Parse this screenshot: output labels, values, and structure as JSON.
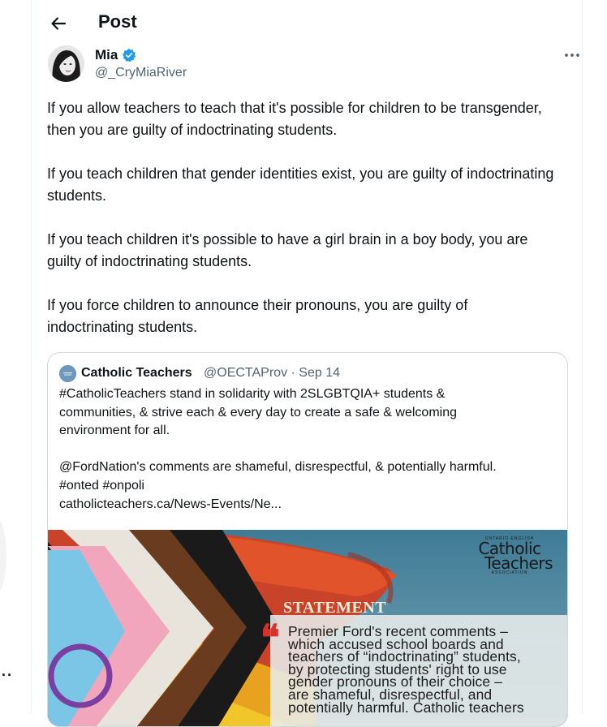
{
  "header": {
    "title": "Post"
  },
  "author": {
    "name": "Mia",
    "handle": "@_CryMiaRiver"
  },
  "post": {
    "paragraphs": [
      "If you allow teachers to teach that it's possible for children to be transgender, then you are guilty of indoctrinating students.",
      "If you teach children that gender identities exist, you are guilty of indoctrinating students.",
      "If you teach children it's possible to have a girl brain in a boy body, you are guilty of indoctrinating students.",
      "If you force children to announce their pronouns, you are guilty of indoctrinating students."
    ]
  },
  "quote": {
    "name": "Catholic Teachers",
    "meta": "@OECTAProv · Sep 14",
    "lines": [
      "#CatholicTeachers stand in solidarity with 2SLGBTQIA+ students &",
      "communities, & strive each & every day to create a safe & welcoming",
      "environment for all.",
      "@FordNation's comments are shameful, disrespectful, & potentially harmful.",
      "#onted #onpoli",
      "catholicteachers.ca/News-Events/Ne..."
    ],
    "media": {
      "brand_small_top": "ONTARIO ENGLISH",
      "brand_line1": "Catholic",
      "brand_line2": "Teachers",
      "brand_small_bottom": "ASSOCIATION",
      "statement_label": "STATEMENT",
      "statement_lines": [
        "Premier Ford's recent comments –",
        "which accused school boards and",
        "teachers of “indoctrinating” students,",
        "by protecting students' right to use",
        "gender pronouns of their choice –",
        "are shameful, disrespectful, and",
        "potentially harmful. Catholic teachers"
      ]
    }
  },
  "colors": {
    "text": "#0f1419",
    "secondary": "#536471",
    "verified": "#1d9bf0",
    "border": "#cfd9de",
    "quote_mark": "#d5332a"
  },
  "icons": {
    "back": "arrow-left-icon",
    "verified": "verified-badge-icon",
    "more": "more-horizontal-icon"
  }
}
